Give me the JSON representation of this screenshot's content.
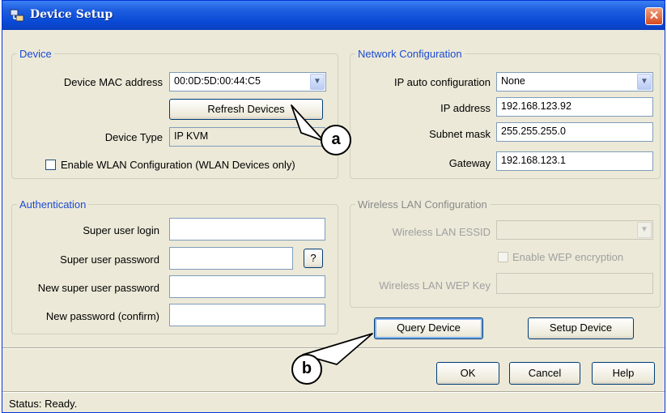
{
  "window": {
    "title": "Device Setup",
    "close_symbol": "✕"
  },
  "device": {
    "legend": "Device",
    "mac_label": "Device MAC address",
    "mac_value": "00:0D:5D:00:44:C5",
    "refresh_label": "Refresh Devices",
    "type_label": "Device Type",
    "type_value": "IP KVM",
    "wlan_checkbox_label": "Enable WLAN Configuration (WLAN Devices only)",
    "wlan_checked": false
  },
  "network": {
    "legend": "Network Configuration",
    "auto_label": "IP auto configuration",
    "auto_value": "None",
    "ip_label": "IP address",
    "ip_value": "192.168.123.92",
    "subnet_label": "Subnet mask",
    "subnet_value": "255.255.255.0",
    "gateway_label": "Gateway",
    "gateway_value": "192.168.123.1"
  },
  "auth": {
    "legend": "Authentication",
    "login_label": "Super user login",
    "password_label": "Super user password",
    "help_symbol": "?",
    "new_password_label": "New super user password",
    "confirm_label": "New password (confirm)"
  },
  "wireless": {
    "legend": "Wireless LAN Configuration",
    "essid_label": "Wireless LAN ESSID",
    "wep_checkbox_label": "Enable WEP encryption",
    "wep_key_label": "Wireless LAN WEP Key"
  },
  "actions": {
    "query_label": "Query Device",
    "setup_label": "Setup Device",
    "ok_label": "OK",
    "cancel_label": "Cancel",
    "help_label": "Help"
  },
  "status": {
    "text": "Status: Ready."
  },
  "callouts": {
    "a": "a",
    "b": "b"
  },
  "icons": {
    "title": "network-device-icon",
    "dropdown": "chevron-down-icon"
  },
  "colors": {
    "title_bar": "#0a4bd7",
    "legend_text": "#1c4bd2",
    "close_button": "#d64a20",
    "dialog_bg": "#ece9d8"
  }
}
